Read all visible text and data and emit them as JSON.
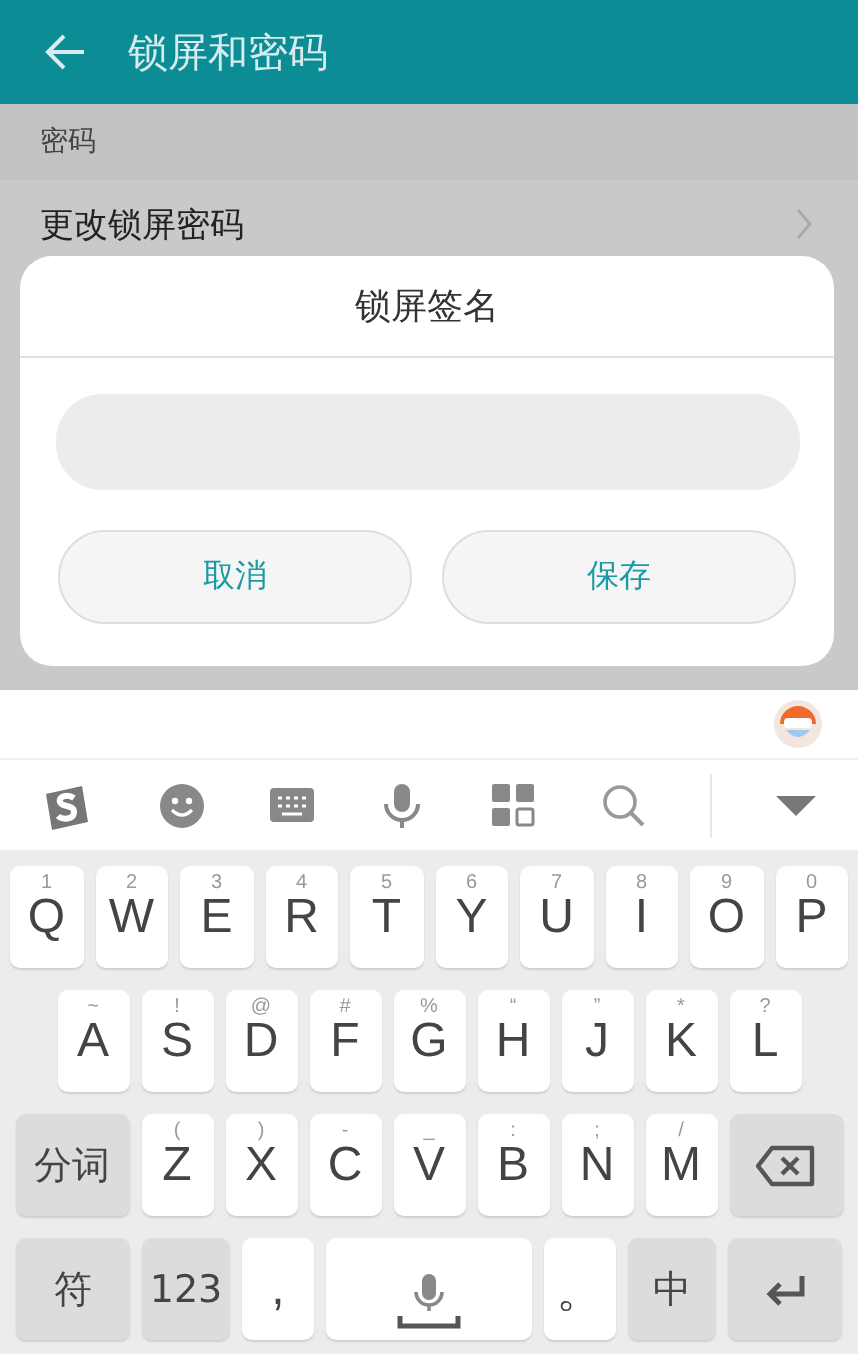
{
  "header": {
    "title": "锁屏和密码"
  },
  "sections": [
    {
      "title": "密码",
      "items": [
        {
          "label": "更改锁屏密码"
        }
      ]
    }
  ],
  "dialog": {
    "title": "锁屏签名",
    "buttons": [
      "取消",
      "保存"
    ]
  },
  "keyboard": {
    "key_rows": [
      {
        "keys": [
          {
            "kind": "letter",
            "label": "Q",
            "hint": "1"
          },
          {
            "kind": "letter",
            "label": "W",
            "hint": "2"
          },
          {
            "kind": "letter",
            "label": "E",
            "hint": "3"
          },
          {
            "kind": "letter",
            "label": "R",
            "hint": "4"
          },
          {
            "kind": "letter",
            "label": "T",
            "hint": "5"
          },
          {
            "kind": "letter",
            "label": "Y",
            "hint": "6"
          },
          {
            "kind": "letter",
            "label": "U",
            "hint": "7"
          },
          {
            "kind": "letter",
            "label": "I",
            "hint": "8"
          },
          {
            "kind": "letter",
            "label": "O",
            "hint": "9"
          },
          {
            "kind": "letter",
            "label": "P",
            "hint": "0"
          }
        ]
      },
      {
        "keys": [
          {
            "kind": "letter",
            "label": "A",
            "hint": "~"
          },
          {
            "kind": "letter",
            "label": "S",
            "hint": "!"
          },
          {
            "kind": "letter",
            "label": "D",
            "hint": "@"
          },
          {
            "kind": "letter",
            "label": "F",
            "hint": "#"
          },
          {
            "kind": "letter",
            "label": "G",
            "hint": "%"
          },
          {
            "kind": "letter",
            "label": "H",
            "hint": "“"
          },
          {
            "kind": "letter",
            "label": "J",
            "hint": "”"
          },
          {
            "kind": "letter",
            "label": "K",
            "hint": "*"
          },
          {
            "kind": "letter",
            "label": "L",
            "hint": "?"
          }
        ]
      },
      {
        "keys": [
          {
            "kind": "function",
            "label": "分词"
          },
          {
            "kind": "letter",
            "label": "Z",
            "hint": "("
          },
          {
            "kind": "letter",
            "label": "X",
            "hint": ")"
          },
          {
            "kind": "letter",
            "label": "C",
            "hint": "-"
          },
          {
            "kind": "letter",
            "label": "V",
            "hint": "_"
          },
          {
            "kind": "letter",
            "label": "B",
            "hint": ":"
          },
          {
            "kind": "letter",
            "label": "N",
            "hint": ";"
          },
          {
            "kind": "letter",
            "label": "M",
            "hint": "/"
          },
          {
            "kind": "backspace"
          }
        ]
      },
      {
        "keys": [
          {
            "kind": "function",
            "label": "符"
          },
          {
            "kind": "function",
            "label": "123"
          },
          {
            "kind": "letter",
            "label": ","
          },
          {
            "kind": "space"
          },
          {
            "kind": "letter",
            "label": "。"
          },
          {
            "kind": "function",
            "label": "中"
          },
          {
            "kind": "enter"
          }
        ]
      }
    ]
  }
}
